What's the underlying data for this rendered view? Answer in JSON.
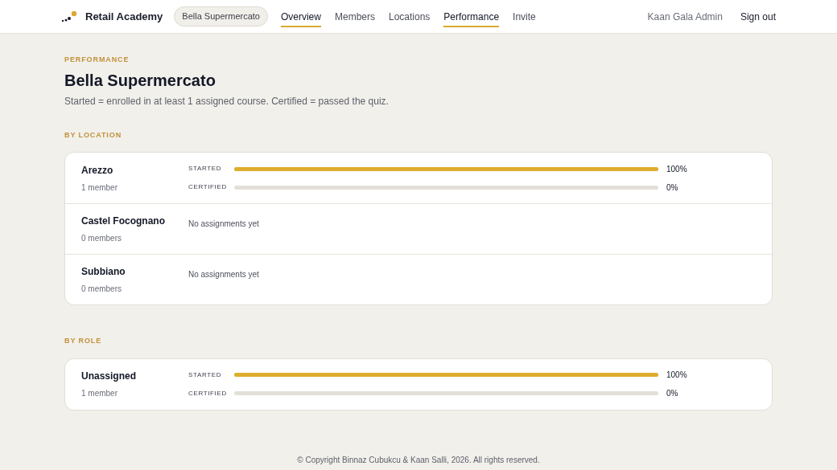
{
  "header": {
    "brand": "Retail Academy",
    "org_badge": "Bella Supermercato",
    "nav": [
      {
        "label": "Overview",
        "selected": true
      },
      {
        "label": "Members",
        "selected": false
      },
      {
        "label": "Locations",
        "selected": false
      },
      {
        "label": "Performance",
        "selected": true
      },
      {
        "label": "Invite",
        "selected": false
      }
    ],
    "user": "Kaan Gala Admin",
    "sign_out": "Sign out"
  },
  "page": {
    "eyebrow": "PERFORMANCE",
    "title": "Bella Supermercato",
    "description": "Started = enrolled in at least 1 assigned course. Certified = passed the quiz."
  },
  "sections": [
    {
      "heading": "BY LOCATION",
      "rows": [
        {
          "name": "Arezzo",
          "members": "1 member",
          "kind": "bars",
          "metrics": [
            {
              "label": "STARTED",
              "level": 1,
              "reading": "100%"
            },
            {
              "label": "CERTIFIED",
              "level": 0,
              "reading": "0%"
            }
          ]
        },
        {
          "name": "Castel Focognano",
          "members": "0 members",
          "kind": "empty",
          "note": "No assignments yet"
        },
        {
          "name": "Subbiano",
          "members": "0 members",
          "kind": "empty",
          "note": "No assignments yet"
        }
      ]
    },
    {
      "heading": "BY ROLE",
      "rows": [
        {
          "name": "Unassigned",
          "members": "1 member",
          "kind": "bars",
          "metrics": [
            {
              "label": "STARTED",
              "level": 1,
              "reading": "100%"
            },
            {
              "label": "CERTIFIED",
              "level": 0,
              "reading": "0%"
            }
          ]
        }
      ]
    }
  ],
  "footer": "© Copyright Binnaz Cubukcu & Kaan Salli, 2026. All rights reserved."
}
